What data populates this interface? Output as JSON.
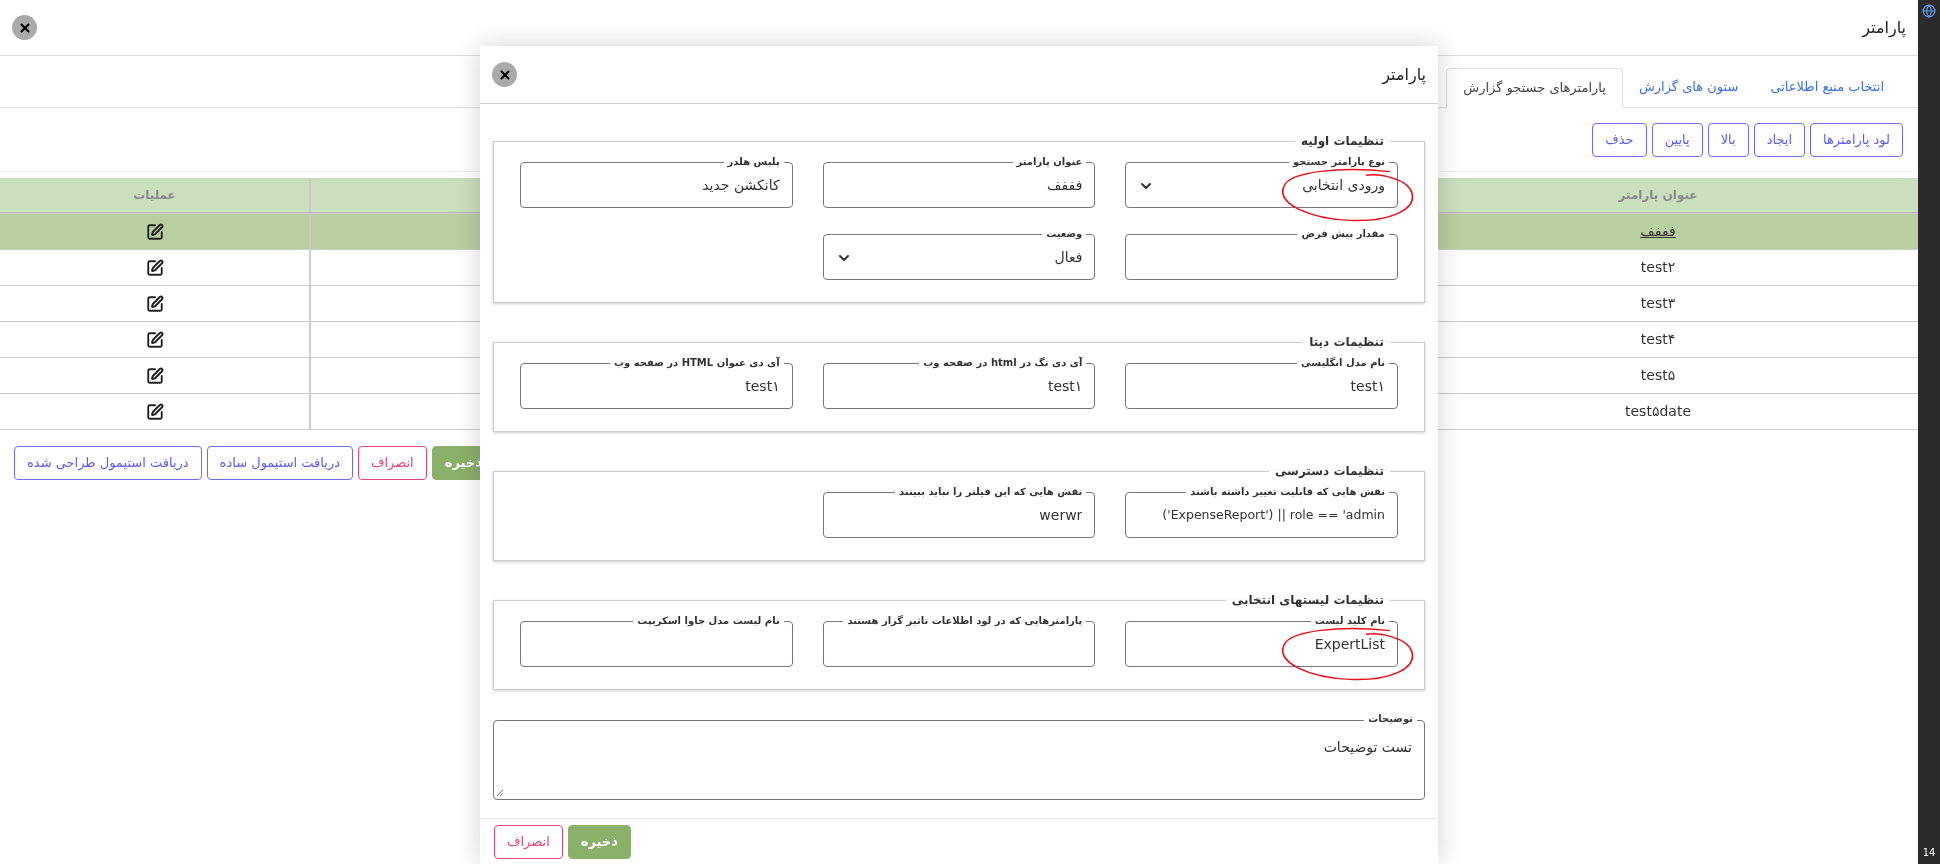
{
  "page": {
    "title": "پارامتر",
    "tabs": [
      {
        "label": "انتخاب منبع اطلاعاتی",
        "selected": false
      },
      {
        "label": "ستون های گزارش",
        "selected": false
      },
      {
        "label": "پارامترهای جستجو گزارش",
        "selected": true
      }
    ],
    "toolbar": [
      "لود پارامترها",
      "ایجاد",
      "بالا",
      "پایین",
      "حذف"
    ],
    "table": {
      "columns": [
        "عنوان پارامتر",
        "عملیات"
      ],
      "rows": [
        {
          "title": "فففف",
          "selected": true
        },
        {
          "title": "test۲",
          "selected": false
        },
        {
          "title": "test۳",
          "selected": false
        },
        {
          "title": "test۴",
          "selected": false
        },
        {
          "title": "test۵",
          "selected": false
        },
        {
          "title": "test۵date",
          "selected": false
        }
      ]
    },
    "buttons": [
      {
        "label": "ذخیره",
        "kind": "primary"
      },
      {
        "label": "انصراف",
        "kind": "cancel"
      },
      {
        "label": "دریافت استیمول ساده",
        "kind": "outline"
      },
      {
        "label": "دریافت استیمول طراحی شده",
        "kind": "outline"
      }
    ]
  },
  "side_strip": {
    "text": "14"
  },
  "modal": {
    "title": "پارامتر",
    "sections": [
      {
        "legend": "تنظیمات اولیه",
        "fields": [
          {
            "label": "نوع پارامتر جستجو",
            "kind": "select",
            "value": "ورودی انتخابی",
            "annotated": true
          },
          {
            "label": "عنوان پارامتر",
            "kind": "text",
            "value": "فففف"
          },
          {
            "label": "پلیس هلدر",
            "kind": "text",
            "value": "کانکشن جدید"
          },
          {
            "label": "مقدار پیش فرض",
            "kind": "text"
          },
          {
            "label": "وضعیت",
            "kind": "select",
            "value": "فعال"
          }
        ]
      },
      {
        "legend": "تنظیمات دیتا",
        "fields": [
          {
            "label": "نام مدل انگلیسی",
            "kind": "text",
            "value": "test۱"
          },
          {
            "label": "آی دی تگ در html در صفحه وب",
            "kind": "text",
            "value": "test۱"
          },
          {
            "label": "آی دی عنوان HTML در صفحه وب",
            "kind": "text",
            "value": "test۱"
          }
        ]
      },
      {
        "legend": "تنظیمات دسترسی",
        "fields": [
          {
            "label": "نقش هایی که قابلیت تغییر داشته باشند",
            "kind": "code",
            "value": "('ExpenseReport') || role == 'admin"
          },
          {
            "label": "نقش هایی که این فیلتر را نباید ببینند",
            "kind": "text",
            "value": "werwr"
          }
        ]
      },
      {
        "legend": "تنظیمات لیستهای انتخابی",
        "fields": [
          {
            "label": "نام کلید لیست",
            "kind": "text",
            "value": "ExpertList",
            "annotated": true
          },
          {
            "label": "پارامترهایی که در لود اطلاعات تاثیر گزار هستند",
            "kind": "text"
          },
          {
            "label": "نام لیست مدل جاوا اسکریپت",
            "kind": "text"
          }
        ]
      }
    ],
    "description": {
      "label": "توضیحات",
      "value": "تست توضیحات"
    },
    "buttons": [
      {
        "label": "ذخیره",
        "kind": "primary"
      },
      {
        "label": "انصراف",
        "kind": "cancel"
      }
    ]
  }
}
